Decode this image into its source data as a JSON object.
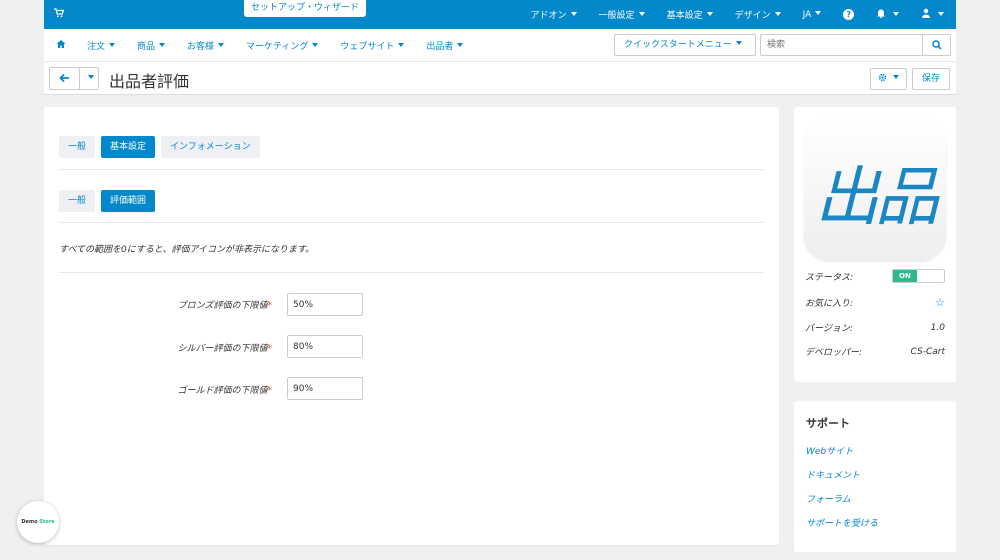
{
  "topbar": {
    "wizard": "セットアップ・ウィザード",
    "menu": [
      "アドオン",
      "一般設定",
      "基本設定",
      "デザイン",
      "JA"
    ]
  },
  "navbar": {
    "menu": [
      "注文",
      "商品",
      "お客様",
      "マーケティング",
      "ウェブサイト",
      "出品者"
    ],
    "quickstart": "クイックスタートメニュー",
    "search_placeholder": "検索"
  },
  "titlebar": {
    "title": "出品者評価",
    "save": "保存"
  },
  "main": {
    "tabs": [
      "一般",
      "基本設定",
      "インフォメーション"
    ],
    "subtabs": [
      "一般",
      "評価範囲"
    ],
    "notice": "すべての範囲を0にすると、評価アイコンが非表示になります。",
    "fields": [
      {
        "label": "ブロンズ評価の下限値",
        "value": "50%"
      },
      {
        "label": "シルバー評価の下限値",
        "value": "80%"
      },
      {
        "label": "ゴールド評価の下限値",
        "value": "90%"
      }
    ]
  },
  "sidebar": {
    "icon_text": "出品",
    "status_label": "ステータス:",
    "status_value": "ON",
    "favorite_label": "お気に入り:",
    "version_label": "バージョン:",
    "version_value": "1.0",
    "developer_label": "デベロッパー:",
    "developer_value": "CS-Cart"
  },
  "support": {
    "title": "サポート",
    "links": [
      "Webサイト",
      "ドキュメント",
      "フォーラム",
      "サポートを受ける"
    ]
  },
  "demo_badge": {
    "part1": "Demo",
    "part2": "Store"
  },
  "colors": {
    "primary": "#0388cc",
    "toggle_on": "#2bbb8b",
    "required": "#e74c3c"
  }
}
